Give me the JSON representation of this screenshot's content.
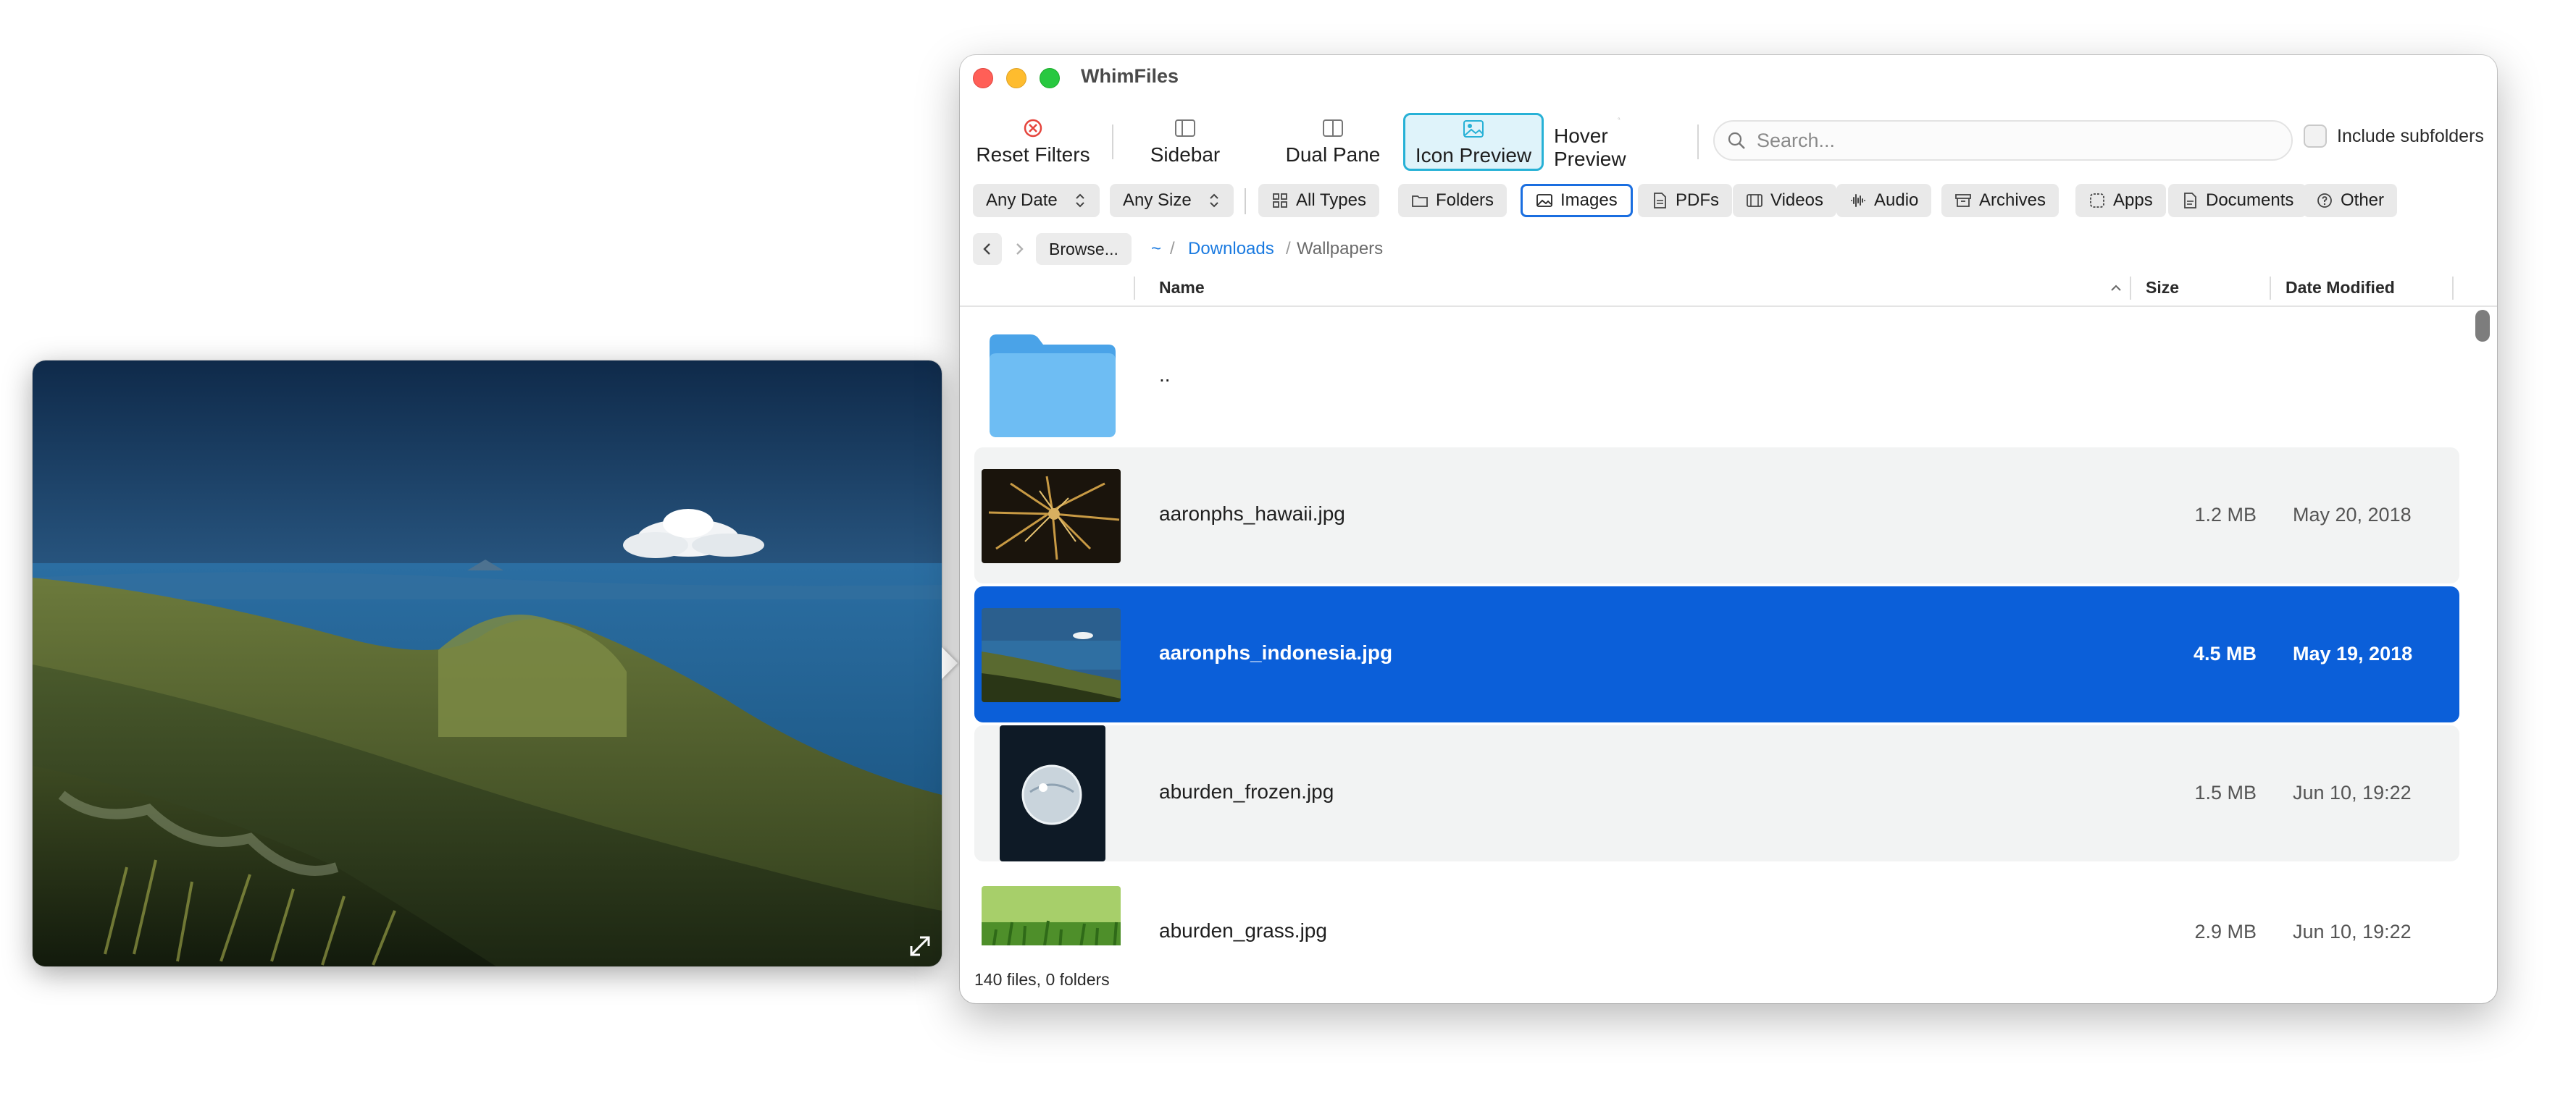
{
  "window": {
    "title": "WhimFiles"
  },
  "toolbar": {
    "buttons": [
      {
        "label": "Reset Filters",
        "icon": "x-circle-icon",
        "color": "#e5443c"
      },
      {
        "label": "Sidebar",
        "icon": "sidebar-icon"
      },
      {
        "label": "Dual Pane",
        "icon": "dual-pane-icon"
      },
      {
        "label": "Icon Preview",
        "icon": "photo-icon",
        "active": true
      },
      {
        "label": "Hover Preview",
        "icon": "magnifier-icon"
      }
    ],
    "search_placeholder": "Search...",
    "include_subfolders_label": "Include subfolders",
    "include_subfolders_checked": false
  },
  "filters": {
    "date": "Any Date",
    "size": "Any Size",
    "types": [
      {
        "label": "All Types",
        "icon": "grid-icon"
      },
      {
        "label": "Folders",
        "icon": "folder-icon"
      },
      {
        "label": "Images",
        "icon": "photo-icon",
        "active": true
      },
      {
        "label": "PDFs",
        "icon": "pdf-icon"
      },
      {
        "label": "Videos",
        "icon": "film-icon"
      },
      {
        "label": "Audio",
        "icon": "waveform-icon"
      },
      {
        "label": "Archives",
        "icon": "archive-box-icon"
      },
      {
        "label": "Apps",
        "icon": "app-icon"
      },
      {
        "label": "Documents",
        "icon": "document-icon"
      },
      {
        "label": "Other",
        "icon": "question-circle-icon"
      }
    ]
  },
  "path": {
    "browse_label": "Browse...",
    "home": "~",
    "separator": "/",
    "crumbs": [
      "Downloads",
      "Wallpapers"
    ]
  },
  "table": {
    "columns": {
      "name": "Name",
      "size": "Size",
      "date": "Date Modified"
    },
    "rows": [
      {
        "name": "..",
        "size": "",
        "date": "",
        "kind": "folder"
      },
      {
        "name": "aaronphs_hawaii.jpg",
        "size": "1.2 MB",
        "date": "May 20, 2018",
        "kind": "image"
      },
      {
        "name": "aaronphs_indonesia.jpg",
        "size": "4.5 MB",
        "date": "May 19, 2018",
        "kind": "image",
        "selected": true
      },
      {
        "name": "aburden_frozen.jpg",
        "size": "1.5 MB",
        "date": "Jun 10, 19:22",
        "kind": "image"
      },
      {
        "name": "aburden_grass.jpg",
        "size": "2.9 MB",
        "date": "Jun 10, 19:22",
        "kind": "image"
      }
    ]
  },
  "status": "140 files, 0 folders",
  "colors": {
    "accent": "#0b5fd9",
    "active_toolbar": "#27b1d6",
    "link": "#1a7ae0"
  }
}
